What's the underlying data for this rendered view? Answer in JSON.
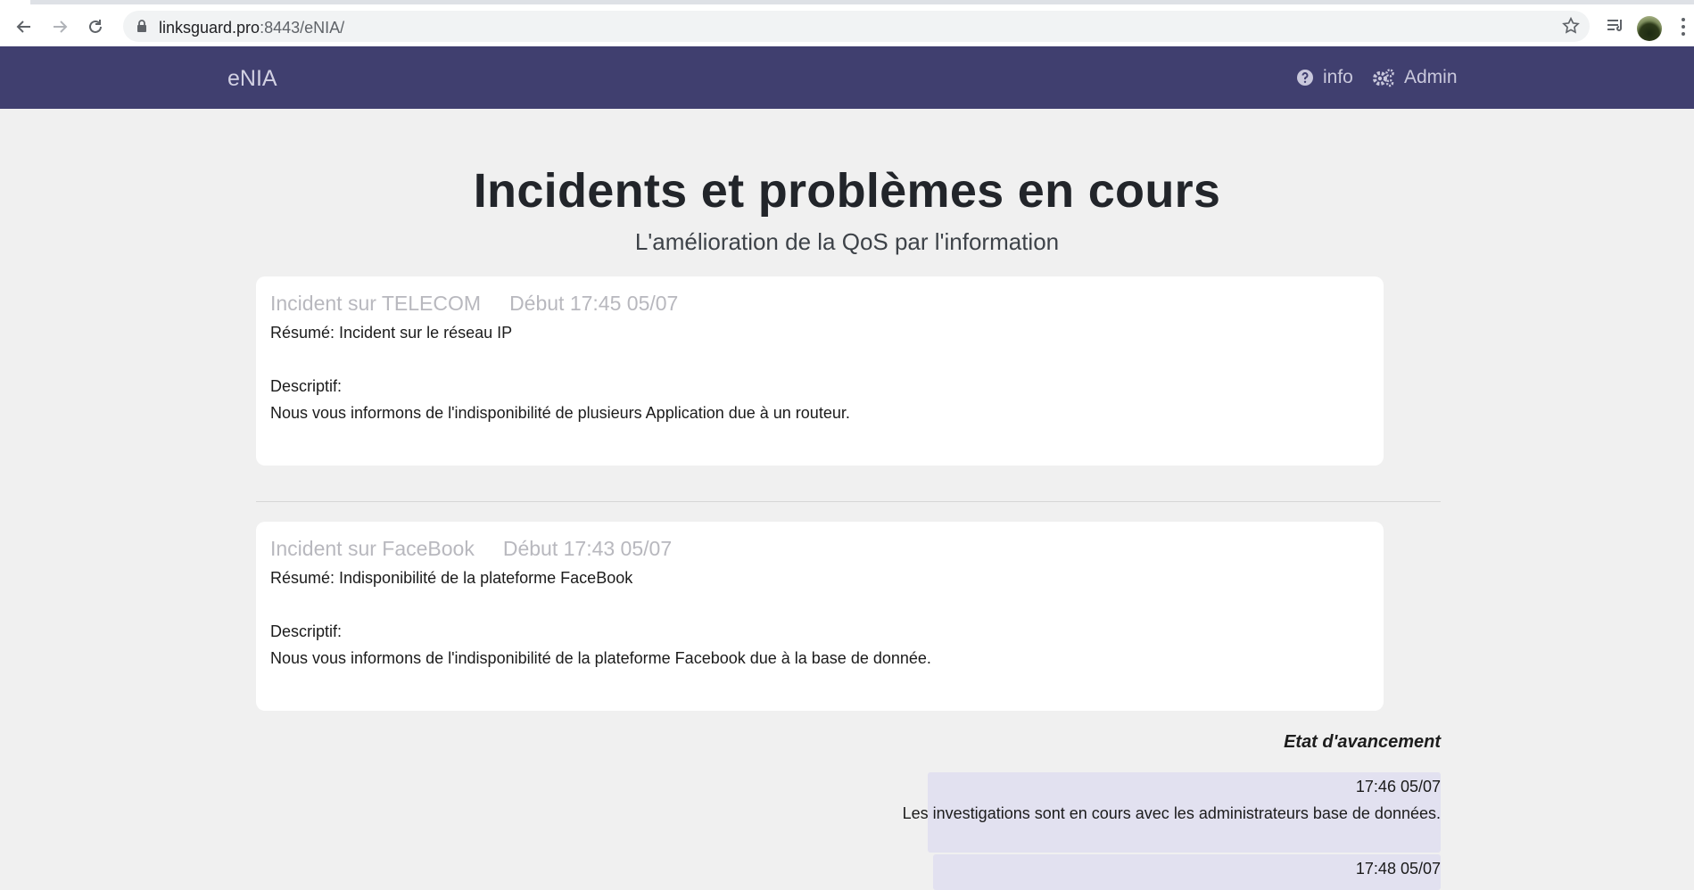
{
  "browser": {
    "url_host": "linksguard.pro",
    "url_rest": ":8443/eNIA/"
  },
  "navbar": {
    "brand": "eNIA",
    "info_label": "info",
    "admin_label": "Admin",
    "background": "#403f6f"
  },
  "page": {
    "title": "Incidents et problèmes en cours",
    "subtitle": "L'amélioration de la QoS par l'information"
  },
  "incidents": [
    {
      "title": "Incident sur TELECOM",
      "start": "Début 17:45 05/07",
      "summary": "Résumé: Incident sur le réseau IP",
      "desc_label": "Descriptif:",
      "description": "Nous vous informons de l'indisponibilité de plusieurs  Application due à un routeur."
    },
    {
      "title": "Incident sur FaceBook",
      "start": "Début 17:43 05/07",
      "summary": "Résumé: Indisponibilité de la plateforme FaceBook",
      "desc_label": "Descriptif:",
      "description": "Nous vous informons de l'indisponibilité de la plateforme Facebook due  à la base de donnée."
    }
  ],
  "progress": {
    "title": "Etat d'avancement",
    "updates": [
      {
        "time": "17:46 05/07",
        "text": "Les investigations sont en cours avec les administrateurs base de données."
      },
      {
        "time": "17:48 05/07",
        "text": ""
      }
    ]
  }
}
